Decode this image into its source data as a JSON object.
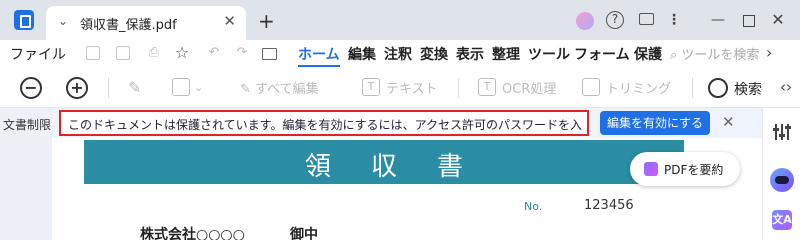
{
  "titlebar": {
    "tab_title": "領収書_保護.pdf",
    "tab_chevron": "⌄",
    "tab_close": "✕",
    "new_tab": "+",
    "help": "?",
    "more": "⋮",
    "minimize": "—",
    "close": "✕"
  },
  "menubar": {
    "file": "ファイル",
    "items": [
      "ホーム",
      "編集",
      "注釈",
      "変換",
      "表示",
      "整理",
      "ツール",
      "フォーム",
      "保護"
    ],
    "active_index": 0,
    "search_placeholder": "ツールを検索",
    "more": "›"
  },
  "toolbar": {
    "zoom_out": "−",
    "zoom_in": "+",
    "edit_all": "すべて編集",
    "text": "テキスト",
    "ocr": "OCR処理",
    "trim": "トリミング",
    "search": "検索",
    "nav": "‹›"
  },
  "restriction": {
    "label": "文書制限",
    "notice": "このドキュメントは保護されています。編集を有効にするには、アクセス許可のパスワードを入力し...",
    "enable_button": "編集を有効にする",
    "close": "✕"
  },
  "right_sidebar": {
    "translate_icon_text": "文A"
  },
  "document": {
    "title": "領収書",
    "summarize_button": "PDFを要約",
    "no_label": "No.",
    "no_value": "123456",
    "company": "株式会社○○○○",
    "honorific": "御中"
  },
  "colors": {
    "accent": "#1f6fe5",
    "title_band": "#2a8da3",
    "notice_border": "#e02424"
  }
}
